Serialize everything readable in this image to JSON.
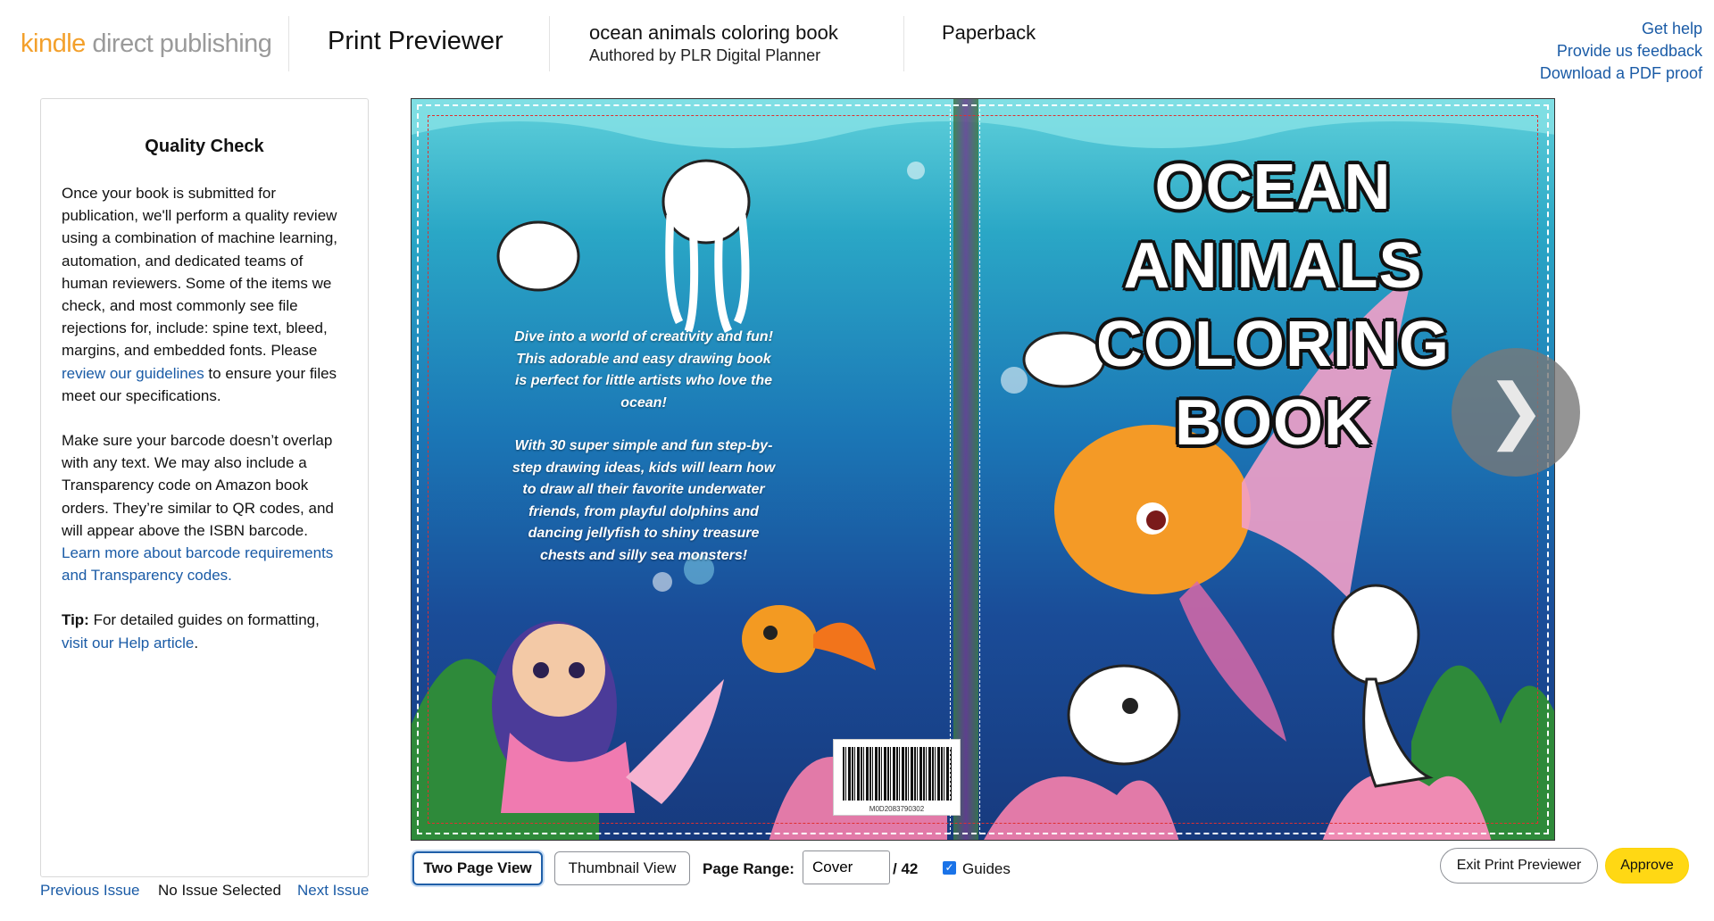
{
  "header": {
    "logo_kindle": "kindle",
    "logo_rest": " direct publishing",
    "title": "Print Previewer",
    "book_title": "ocean animals coloring book",
    "book_author": "Authored by PLR Digital Planner",
    "format": "Paperback",
    "links": [
      "Get help",
      "Provide us feedback",
      "Download a PDF proof"
    ]
  },
  "sidebar": {
    "title": "Quality Check",
    "p1_text": "Once your book is submitted for publication, we'll perform a quality review using a combination of machine learning, automation, and dedicated teams of human reviewers. Some of the items we check, and most commonly see file rejections for, include: spine text, bleed, margins, and embedded fonts. Please ",
    "p1_link": "review our guidelines",
    "p1_tail": " to ensure your files meet our specifications.",
    "p2_text": "Make sure your barcode doesn’t overlap with any text. We may also include a Transparency code on Amazon book orders. They’re similar to QR codes, and will appear above the ISBN barcode. ",
    "p2_link": "Learn more about barcode requirements and Transparency codes.",
    "tip_label": "Tip:",
    "tip_text": " For detailed guides on formatting, ",
    "tip_link": "visit our Help article",
    "tip_tail": "."
  },
  "issue_nav": {
    "prev": "Previous Issue",
    "current": "No Issue Selected",
    "next": "Next Issue"
  },
  "cover": {
    "back_text_1": "Dive into a world of creativity and fun! This adorable and easy drawing book is perfect for little artists who love the ocean!",
    "back_text_2": "With 30 super simple and fun step-by-step drawing ideas, kids will learn how to draw all their favorite underwater friends, from playful dolphins and dancing jellyfish to shiny treasure chests and silly sea monsters!",
    "front_title_1": "OCEAN ANIMALS",
    "front_title_2": "COLORING BOOK",
    "barcode_number": "M0D2083790302",
    "next_arrow": "❯"
  },
  "toolbar": {
    "two_page_view": "Two Page View",
    "thumbnail_view": "Thumbnail View",
    "page_range_label": "Page Range:",
    "page_range_value": "Cover",
    "page_total": "/ 42",
    "guides_checked": true,
    "guides_label": "Guides",
    "exit": "Exit Print Previewer",
    "approve": "Approve"
  },
  "colors": {
    "link": "#1a5ba6",
    "approve_bg": "#ffd814",
    "logo_orange": "#f3a02b",
    "primary_border": "#1f5fa8"
  }
}
